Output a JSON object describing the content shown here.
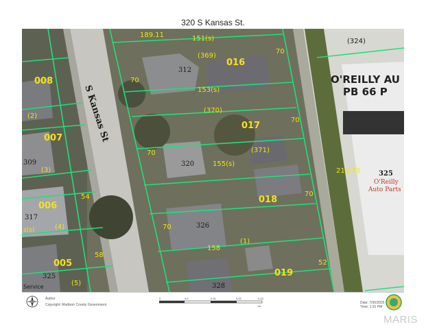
{
  "title": "320 S Kansas St.",
  "street_label": "S Kansas St",
  "house_numbers": [
    "312",
    "320",
    "326",
    "328",
    "309",
    "317",
    "325",
    "325"
  ],
  "parcel_ids": [
    "016",
    "017",
    "018",
    "019",
    "008",
    "007",
    "006",
    "005"
  ],
  "parcel_refs": [
    "(369)",
    "(370)",
    "(371)",
    "(1)",
    "(2)",
    "(3)",
    "(4)",
    "(5)",
    "(324)"
  ],
  "dimensions": [
    "189.11",
    "151(s)",
    "153(s)",
    "155(s)",
    "158",
    "70",
    "70",
    "70",
    "70",
    "54",
    "58",
    "52",
    "210.73",
    "70",
    "70"
  ],
  "business": {
    "sign": "O'REILLY AU",
    "plat": "PB 66 P",
    "number": "325",
    "name_line1": "O'Reilly",
    "name_line2": "Auto Parts"
  },
  "partial_labels": {
    "service": "Service",
    "small_a": "s(s)",
    "small_b": "(5)"
  },
  "footer": {
    "author_label": "Author",
    "copyright": "Copyright: Madison County Government",
    "scale_ticks": [
      "0",
      "0.0",
      "0.01",
      "0.02",
      "0.03"
    ],
    "scale_unit": "mi",
    "date": "Date: 7/30/2025",
    "time": "Time: 1:31 PM"
  },
  "brand": "MARIS",
  "colors": {
    "parcel_line": "#1fe07a",
    "parcel_id": "#f5e21a",
    "dimension": "#f2e60a",
    "street": "#c9c9c9",
    "building_roof": "#8f8f8f"
  }
}
